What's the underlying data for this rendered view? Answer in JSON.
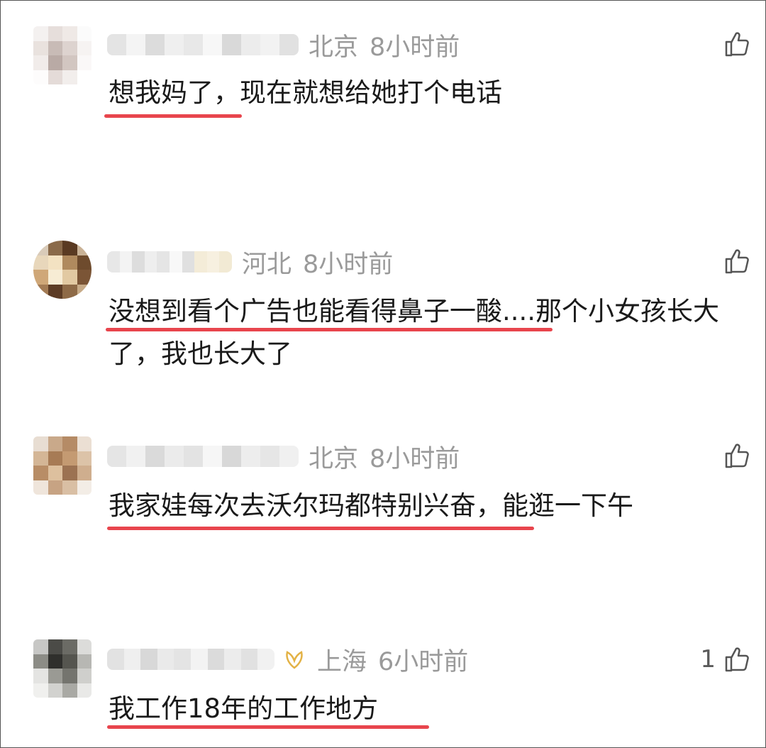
{
  "comments": [
    {
      "location": "北京",
      "time": "8小时前",
      "text": "想我妈了，现在就想给她打个电话",
      "like_count": "",
      "avatar_colors": [
        "#f4f1f0",
        "#e6dedb",
        "#efe9e6",
        "#fbfbfb",
        "#e9e2de",
        "#c8bbb6",
        "#ddd3cf",
        "#f6f3f2",
        "#f1ecea",
        "#b9aaa5",
        "#d2c6c1",
        "#faf8f8",
        "#fdfcfc",
        "#e4dbd8",
        "#f2eeec",
        "#ffffff"
      ],
      "nick_colors": [
        "#e4e4e4",
        "#f4f4f4",
        "#dcdcdc",
        "#efefef",
        "#e8e8e8",
        "#f7f7f7",
        "#d9d9d9",
        "#ececec",
        "#f2f2f2",
        "#e1e1e1"
      ]
    },
    {
      "location": "河北",
      "time": "8小时前",
      "text": "没想到看个广告也能看得鼻子一酸....那个小女孩长大了，我也长大了",
      "like_count": "",
      "avatar_colors": [
        "#d9cbb9",
        "#8a6a4a",
        "#5a3a22",
        "#c9b296",
        "#e8d7bb",
        "#f3e2c2",
        "#b08a5e",
        "#6e4b2d",
        "#cfa778",
        "#f7ecd4",
        "#e2c9a2",
        "#7b5536",
        "#a37b54",
        "#5d3c25",
        "#8e6a47",
        "#c7ab88"
      ],
      "nick_colors": [
        "#e7e7e7",
        "#f3f3f3",
        "#dddddd",
        "#eeeeee",
        "#e5e5e5",
        "#f8f8f8",
        "#e0e0e0",
        "#f4ecd8",
        "#f7f0e0",
        "#f2ead4"
      ]
    },
    {
      "location": "北京",
      "time": "8小时前",
      "text": "我家娃每次去沃尔玛都特别兴奋，能逛一下午",
      "like_count": "",
      "avatar_colors": [
        "#e8ddd2",
        "#c9a98a",
        "#b58b66",
        "#ebdfd3",
        "#d4b696",
        "#a77b55",
        "#c49a72",
        "#dcc3a8",
        "#b88d66",
        "#ddc09e",
        "#9c7252",
        "#cfae8e",
        "#efe5db",
        "#c7a383",
        "#d9bfa4",
        "#f3ede6"
      ],
      "nick_colors": [
        "#e5e5e5",
        "#f1f1f1",
        "#dadada",
        "#ebebeb",
        "#e3e3e3",
        "#f6f6f6",
        "#d8d8d8",
        "#ededed",
        "#e6e6e6",
        "#f0f0f0"
      ]
    },
    {
      "location": "上海",
      "time": "6小时前",
      "text": "我工作18年的工作地方",
      "like_count": "1",
      "avatar_colors": [
        "#c7c7c5",
        "#4b4b47",
        "#6b6b65",
        "#dcdcda",
        "#8c8c86",
        "#2f2f2c",
        "#55554f",
        "#b7b7b3",
        "#e4e4e2",
        "#9a9a94",
        "#74746e",
        "#cfcfcc",
        "#f0f0ee",
        "#d2d2cf",
        "#a9a9a4",
        "#e9e9e7"
      ],
      "nick_colors": [
        "#e2e2e2",
        "#efefef",
        "#d8d8d8",
        "#eaeaea",
        "#e4e4e4",
        "#f3f3f3",
        "#dbdbdb",
        "#ececec",
        "#e1e1e1",
        "#f1f1f1"
      ]
    }
  ],
  "icons": {
    "like": "thumbs-up-icon",
    "flower": "flower-icon"
  },
  "colors": {
    "underline": "#e8454d",
    "meta_text": "#9a9a9a",
    "comment_text": "#1a1a1a"
  }
}
